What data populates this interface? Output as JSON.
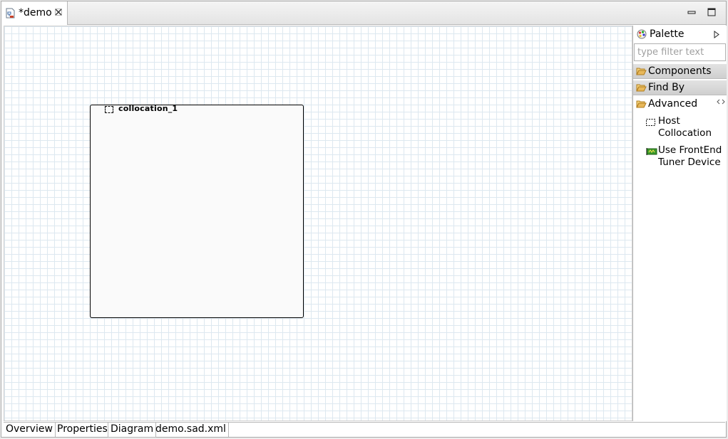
{
  "editor_tab": {
    "title": "*demo",
    "file_icon": "diagram-file-icon",
    "close_icon": "close-icon"
  },
  "window_controls": {
    "minimize_icon": "minimize-icon",
    "maximize_icon": "maximize-icon"
  },
  "diagram": {
    "collocation": {
      "label": "collocation_1",
      "icon": "host-collocation-icon"
    }
  },
  "palette": {
    "title": "Palette",
    "icon": "palette-icon",
    "collapse_icon": "triangle-right-icon",
    "filter": {
      "placeholder": "type filter text",
      "value": ""
    },
    "drawers": [
      {
        "label": "Components",
        "open": false
      },
      {
        "label": "Find By",
        "open": false
      },
      {
        "label": "Advanced",
        "open": true
      }
    ],
    "tools": [
      {
        "line1": "Host",
        "line2": "Collocation",
        "icon": "host-collocation-icon"
      },
      {
        "line1": "Use FrontEnd",
        "line2": "Tuner Device",
        "icon": "frontend-tuner-icon"
      }
    ]
  },
  "bottom_tabs": [
    {
      "label": "Overview"
    },
    {
      "label": "Properties"
    },
    {
      "label": "Diagram",
      "active": true
    },
    {
      "label": "demo.sad.xml"
    }
  ],
  "colors": {
    "grid": "#dde8f0",
    "folder": "#e8b85a",
    "tuner_icon": "#3a9a2a"
  }
}
